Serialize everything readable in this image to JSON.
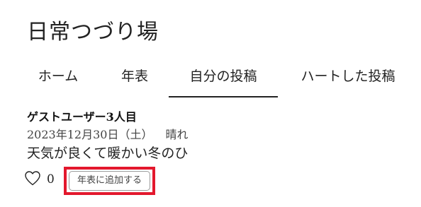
{
  "app": {
    "title": "日常つづり場"
  },
  "tabs": [
    {
      "label": "ホーム",
      "active": false
    },
    {
      "label": "年表",
      "active": false
    },
    {
      "label": "自分の投稿",
      "active": true
    },
    {
      "label": "ハートした投稿",
      "active": false
    }
  ],
  "post": {
    "user": "ゲストユーザー3人目",
    "date": "2023年12月30日（土）",
    "weather": "晴れ",
    "body": "天気が良くて暖かい冬のひ",
    "likes": "0",
    "like_icon": "heart-outline-icon",
    "add_to_timeline_label": "年表に追加する"
  },
  "colors": {
    "text": "#222222",
    "highlight": "#e3182d",
    "button_border": "#9a9a9a",
    "background": "#ffffff"
  }
}
